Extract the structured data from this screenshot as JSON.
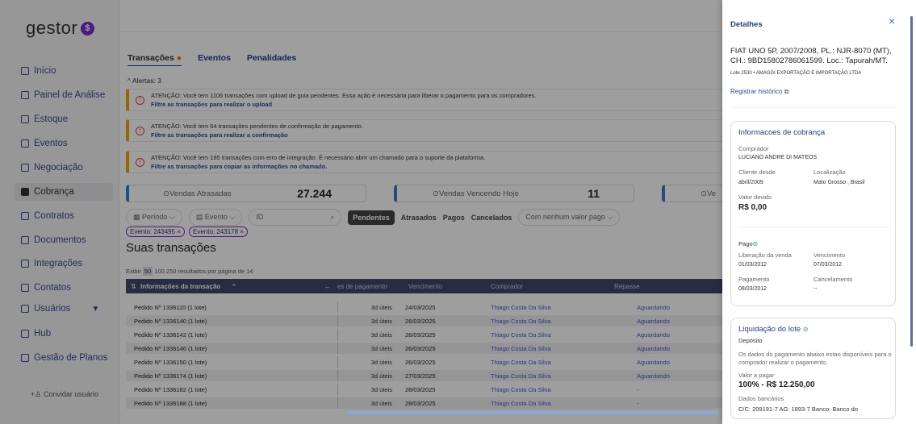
{
  "brand": {
    "name": "gestor",
    "mark": "$"
  },
  "sidebar": {
    "items": [
      {
        "label": "Início",
        "icon": "home-icon"
      },
      {
        "label": "Painel de Análise",
        "icon": "chart-icon"
      },
      {
        "label": "Estoque",
        "icon": "list-icon"
      },
      {
        "label": "Eventos",
        "icon": "calendar-icon"
      },
      {
        "label": "Negociação",
        "icon": "handshake-icon"
      },
      {
        "label": "Cobrança",
        "icon": "billing-icon"
      },
      {
        "label": "Contratos",
        "icon": "contract-icon"
      },
      {
        "label": "Documentos",
        "icon": "document-icon"
      },
      {
        "label": "Integrações",
        "icon": "puzzle-icon"
      },
      {
        "label": "Contatos",
        "icon": "contact-icon"
      },
      {
        "label": "Usuários",
        "icon": "user-icon"
      },
      {
        "label": "Hub",
        "icon": "hub-icon"
      },
      {
        "label": "Gestão de Planos",
        "icon": "plan-icon"
      }
    ],
    "invite": "Convidar usuário"
  },
  "tabs": {
    "t1": "Transações",
    "t1_dot": "●",
    "t2": "Eventos",
    "t3": "Penalidades"
  },
  "alerts": {
    "header": "Alertas: 3",
    "items": [
      {
        "text": "ATENÇÃO: Você tem 1106 transações com upload de guia pendentes. Essa ação é necessária para liberar o pagamento para os compradores.",
        "link": "Filtre as transações para realizar o upload"
      },
      {
        "text": "ATENÇÃO: Você tem 64 transações pendentes de confirmação de pagamento.",
        "link": "Filtre as transações para realizar a confirmação"
      },
      {
        "text": "ATENÇÃO: Você tem 195 transações com erro de integração. É necessário abrir um chamado para o suporte da plataforma.",
        "link": "Filtre as transações para copiar as informações no chamado."
      }
    ]
  },
  "stats": {
    "atrasadas_label": "Vendas Atrasadas",
    "atrasadas_value": "27.244",
    "vencendo_label": "Vendas Vencendo Hoje",
    "vencendo_value": "11",
    "third_label": "Ve"
  },
  "filters": {
    "periodo": "Período",
    "evento": "Evento",
    "id_placeholder": "ID",
    "pendentes": "Pendentes",
    "atrasados": "Atrasados",
    "pagos": "Pagos",
    "cancelados": "Cancelados",
    "valor": "Com nenhum valor pago"
  },
  "tags": [
    "Evento: 243495 ×",
    "Evento: 243178 ×"
  ],
  "page_title": "Suas transações",
  "per_page": {
    "prefix": "Exibir",
    "opt1": "50",
    "rest": "100  250  resultados por página de 14"
  },
  "table": {
    "headers": [
      "Informações da transação",
      "es de pagamento",
      "Vencimento",
      "Comprador",
      "Repasse"
    ],
    "rows": [
      {
        "pedido": "Pedido Nº 1336110 (1 lote)",
        "prazo": "3d úteis",
        "venc": "24/03/2025",
        "comprador": "Thiago Costa Da Silva",
        "repasse": "Aguardando"
      },
      {
        "pedido": "Pedido Nº 1336140 (1 lote)",
        "prazo": "3d úteis",
        "venc": "26/03/2025",
        "comprador": "Thiago Costa Da Silva",
        "repasse": "Aguardando"
      },
      {
        "pedido": "Pedido Nº 1336142 (1 lote)",
        "prazo": "3d úteis",
        "venc": "26/03/2025",
        "comprador": "Thiago Costa Da Silva",
        "repasse": "Aguardando"
      },
      {
        "pedido": "Pedido Nº 1336146 (1 lote)",
        "prazo": "3d úteis",
        "venc": "26/03/2025",
        "comprador": "Thiago Costa Da Silva",
        "repasse": "Aguardando"
      },
      {
        "pedido": "Pedido Nº 1336150 (1 lote)",
        "prazo": "3d úteis",
        "venc": "26/03/2025",
        "comprador": "Thiago Costa Da Silva",
        "repasse": "Aguardando"
      },
      {
        "pedido": "Pedido Nº 1336174 (1 lote)",
        "prazo": "3d úteis",
        "venc": "27/03/2025",
        "comprador": "Thiago Costa Da Silva",
        "repasse": "Aguardando"
      },
      {
        "pedido": "Pedido Nº 1336182 (1 lote)",
        "prazo": "3d úteis",
        "venc": "28/03/2025",
        "comprador": "Thiago Costa Da Silva",
        "repasse": "-"
      },
      {
        "pedido": "Pedido Nº 1336188 (1 lote)",
        "prazo": "3d úteis",
        "venc": "28/03/2025",
        "comprador": "Thiago Costa Da Silva",
        "repasse": "-"
      }
    ]
  },
  "panel": {
    "title": "Detalhes",
    "close": "×",
    "car": "FIAT UNO 5P, 2007/2008, PL.: NJR-8070 (MT), CH.: 9BD15802786061599. Loc.: Tapurah/MT.",
    "lote": "Lote 2530 • AMAGGI EXPORTAÇÃO E IMPORTAÇÃO LTDA",
    "registrar": "Registrar histórico",
    "cobranca": {
      "title": "Informacoes de cobrança",
      "comprador_label": "Comprador",
      "comprador": "LUCIANO ANDRE DI MATEOS",
      "cliente_label": "Cliente desde",
      "cliente": "abril/2009",
      "loc_label": "Localização",
      "loc": "Mato Grosso , Brasil",
      "valor_label": "Valor devido",
      "valor": "R$ 0,00",
      "pago": "Pago",
      "lib_label": "Liberação da venda",
      "lib": "01/03/2012",
      "venc_label": "Vencimento",
      "venc": "07/03/2012",
      "pag_label": "Pagamento",
      "pag": "08/03/2012",
      "canc_label": "Cancelamento",
      "canc": "--"
    },
    "liquidacao": {
      "title": "Liquidação do lote",
      "deposito": "Depósito",
      "info": "Os dados do pagamento abaixo estao disponíveis para o comprador realizar o pagamento.",
      "valor_label": "Valor a pagar",
      "valor": "100% - R$ 12.250,00",
      "bancarios_label": "Dados bancários",
      "bancarios": "C/C: 209191-7 AG: 1893-7 Banco: Banco do"
    }
  }
}
